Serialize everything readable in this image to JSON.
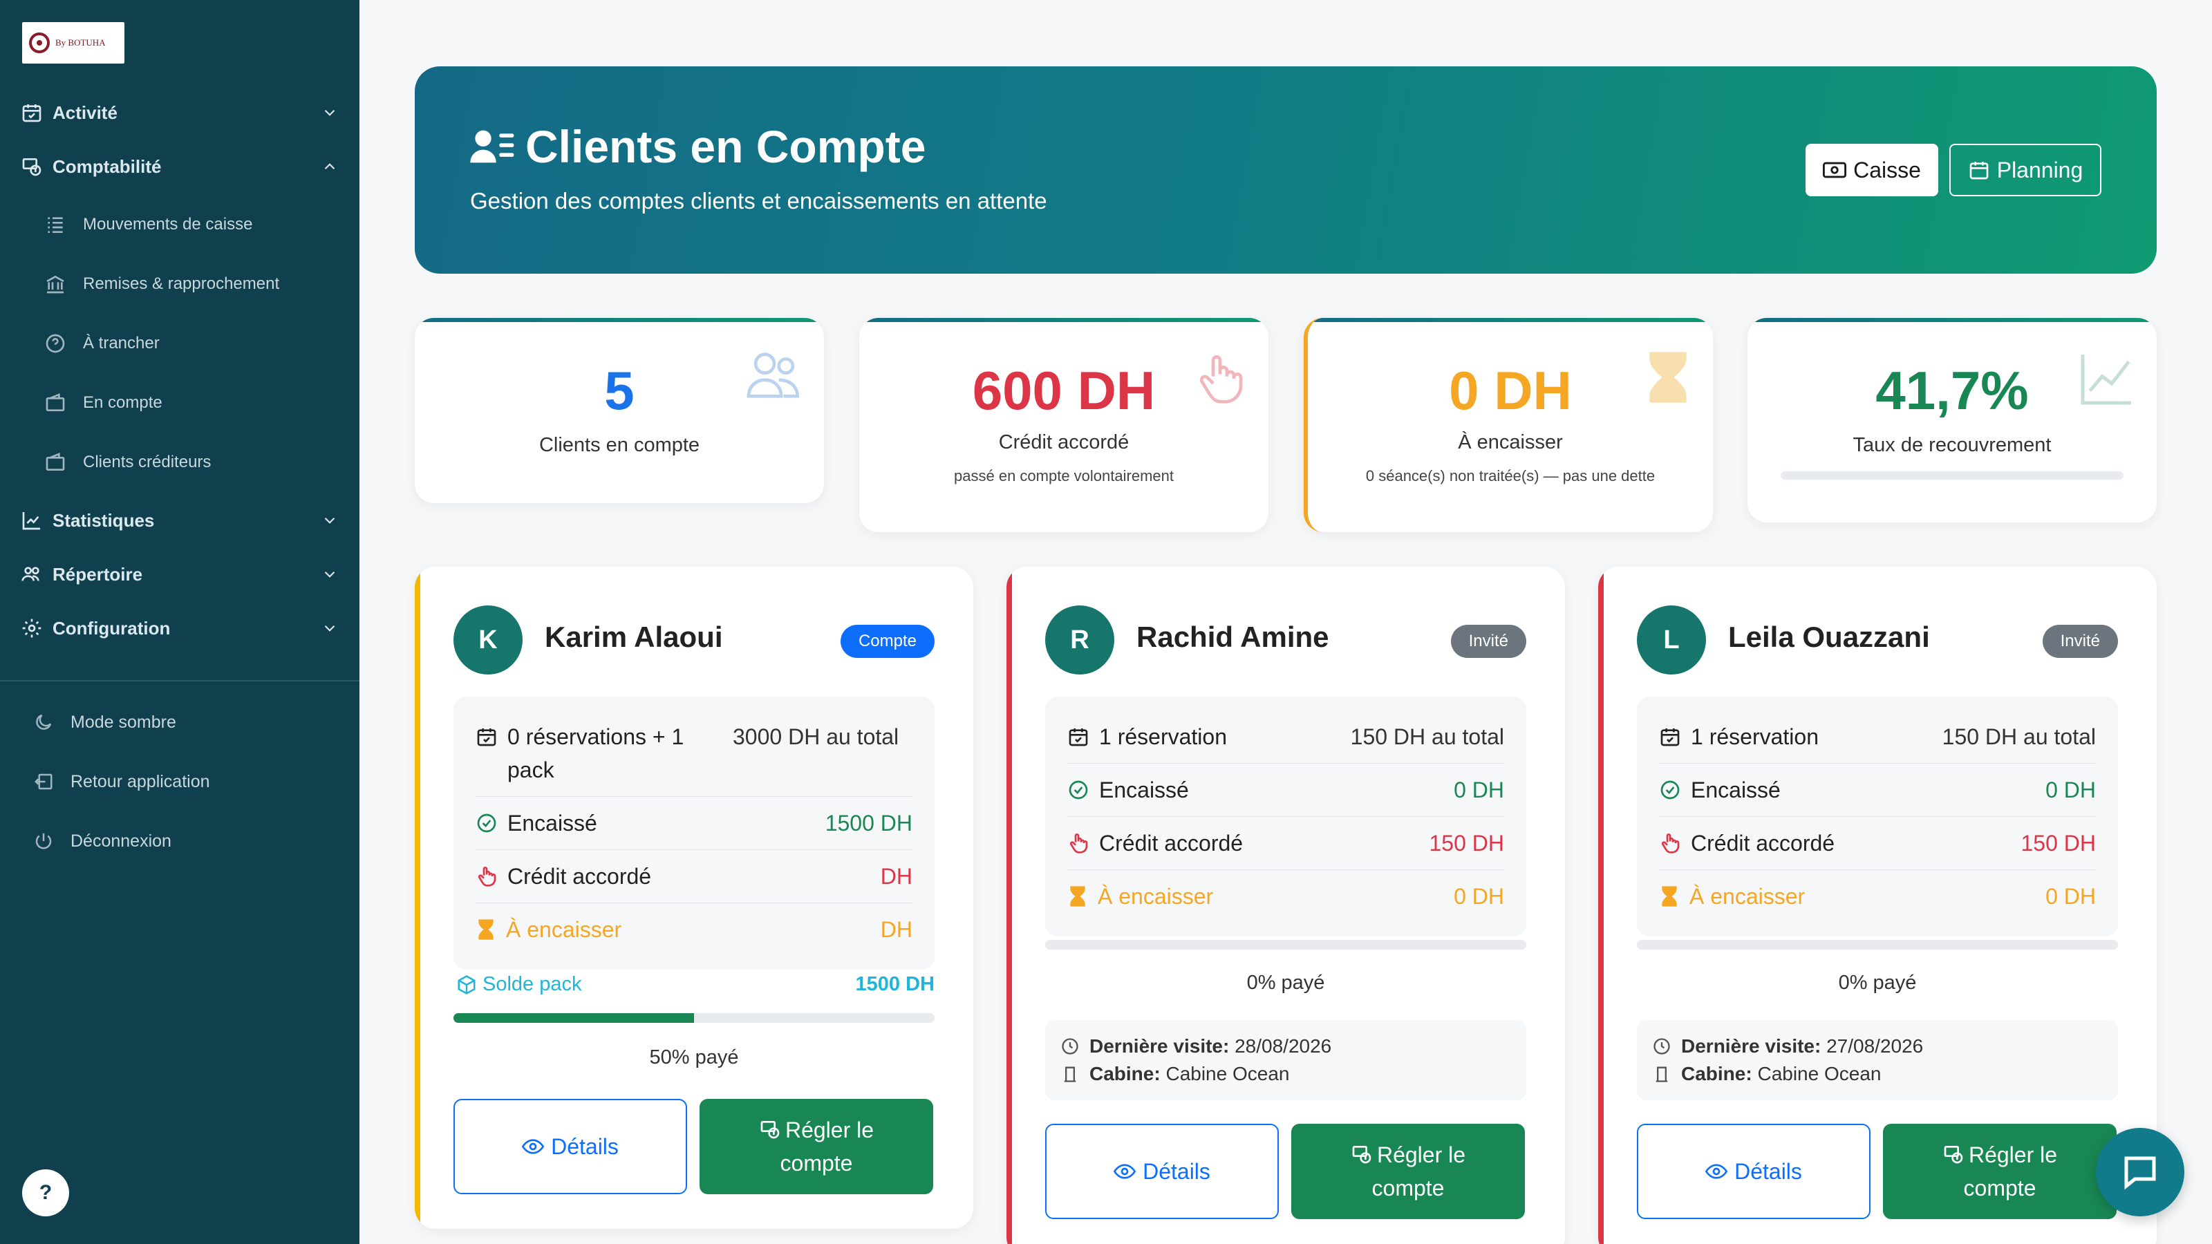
{
  "sidebar": {
    "logo_text": "By BOTUHA",
    "sections": {
      "activite": "Activité",
      "comptabilite": "Comptabilité",
      "statistiques": "Statistiques",
      "repertoire": "Répertoire",
      "configuration": "Configuration"
    },
    "sub_items": [
      "Mouvements de caisse",
      "Remises & rapprochement",
      "À trancher",
      "En compte",
      "Clients créditeurs"
    ],
    "bottom": [
      "Mode sombre",
      "Retour application",
      "Déconnexion"
    ],
    "help": "?"
  },
  "header": {
    "title": "Clients en Compte",
    "subtitle": "Gestion des comptes clients et encaissements en attente",
    "caisse_label": "Caisse",
    "planning_label": "Planning"
  },
  "stats": [
    {
      "value": "5",
      "label": "Clients en compte",
      "note": "",
      "color": "#1a73e8"
    },
    {
      "value": "600 DH",
      "label": "Crédit accordé",
      "note": "passé en compte volontairement",
      "color": "#dc3545"
    },
    {
      "value": "0 DH",
      "label": "À encaisser",
      "note": "0 séance(s) non traitée(s) — pas une dette",
      "color": "#f5a623"
    },
    {
      "value": "41,7%",
      "label": "Taux de recouvrement",
      "note": "",
      "color": "#198754"
    }
  ],
  "colors": {
    "brand_dark": "#103f4e",
    "green": "#198754",
    "red": "#dc3545",
    "orange": "#f5a623",
    "blue": "#0d6efd",
    "cyan": "#1eb5d8",
    "grey_badge": "#6c757d"
  },
  "clients": [
    {
      "initial": "K",
      "name": "Karim Alaoui",
      "badge": "Compte",
      "reservations": "0 réservations + 1 pack",
      "total": "3000 DH au total",
      "encaisse_label": "Encaissé",
      "encaisse": "1500 DH",
      "credit_label": "Crédit accordé",
      "credit": "DH",
      "a_encaisser_label": "À encaisser",
      "a_encaisser": "DH",
      "solde_label": "Solde pack",
      "solde": "1500 DH",
      "paid_percent": 50,
      "paid_text": "50% payé",
      "details_label": "Détails",
      "regler_label": "Régler le compte"
    },
    {
      "initial": "R",
      "name": "Rachid Amine",
      "badge": "Invité",
      "reservations": "1 réservation",
      "total": "150 DH au total",
      "encaisse_label": "Encaissé",
      "encaisse": "0 DH",
      "credit_label": "Crédit accordé",
      "credit": "150 DH",
      "a_encaisser_label": "À encaisser",
      "a_encaisser": "0 DH",
      "paid_percent": 0,
      "paid_text": "0% payé",
      "last_visit_label": "Dernière visite:",
      "last_visit": "28/08/2026",
      "cabine_label": "Cabine:",
      "cabine": "Cabine Ocean",
      "details_label": "Détails",
      "regler_label": "Régler le compte"
    },
    {
      "initial": "L",
      "name": "Leila Ouazzani",
      "badge": "Invité",
      "reservations": "1 réservation",
      "total": "150 DH au total",
      "encaisse_label": "Encaissé",
      "encaisse": "0 DH",
      "credit_label": "Crédit accordé",
      "credit": "150 DH",
      "a_encaisser_label": "À encaisser",
      "a_encaisser": "0 DH",
      "paid_percent": 0,
      "paid_text": "0% payé",
      "last_visit_label": "Dernière visite:",
      "last_visit": "27/08/2026",
      "cabine_label": "Cabine:",
      "cabine": "Cabine Ocean",
      "details_label": "Détails",
      "regler_label": "Régler le compte"
    }
  ]
}
